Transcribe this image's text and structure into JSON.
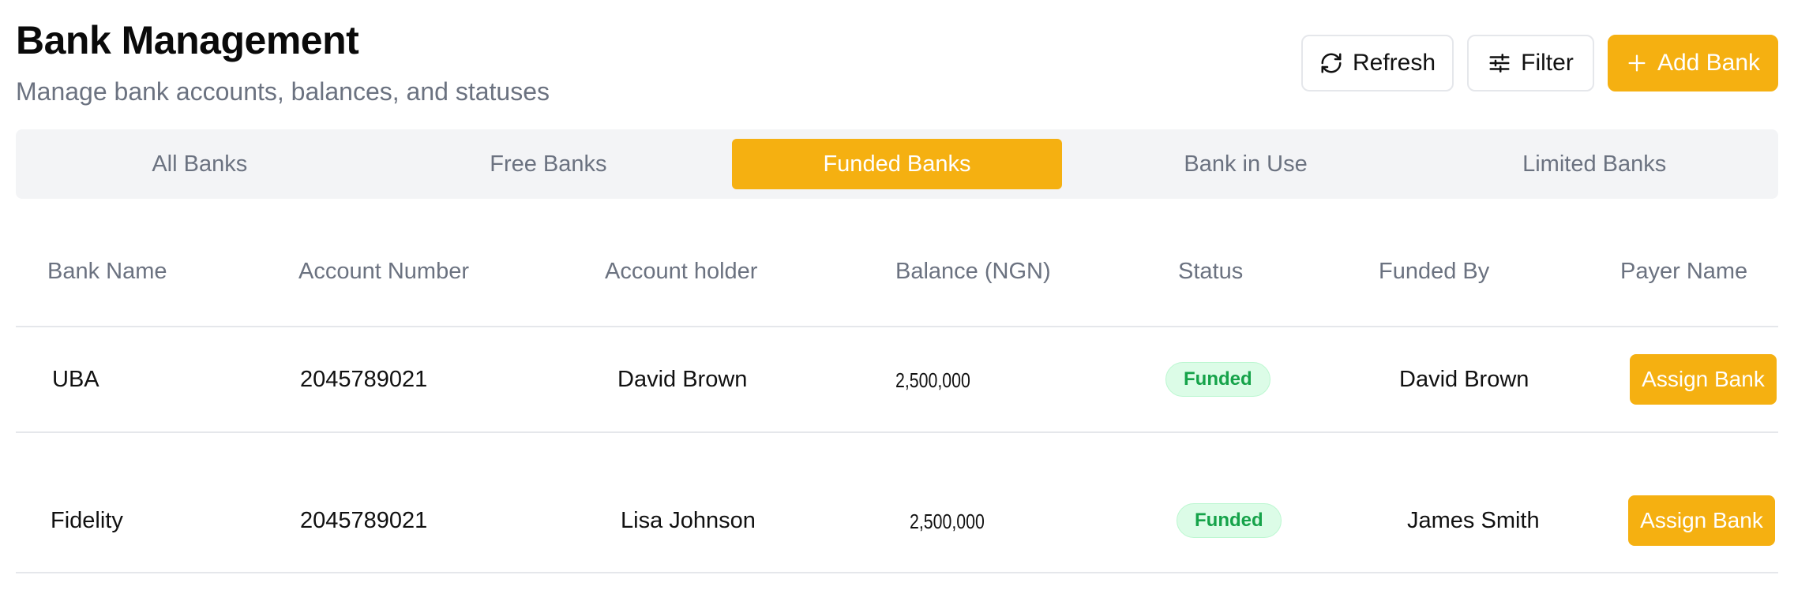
{
  "header": {
    "title": "Bank Management",
    "subtitle": "Manage bank accounts, balances, and statuses"
  },
  "toolbar": {
    "refresh_label": "Refresh",
    "filter_label": "Filter",
    "add_label": "Add Bank"
  },
  "tabs": [
    {
      "label": "All Banks",
      "active": false
    },
    {
      "label": "Free Banks",
      "active": false
    },
    {
      "label": "Funded Banks",
      "active": true
    },
    {
      "label": "Bank in Use",
      "active": false
    },
    {
      "label": "Limited Banks",
      "active": false
    }
  ],
  "table": {
    "columns": [
      "Bank Name",
      "Account Number",
      "Account holder",
      "Balance (NGN)",
      "Status",
      "Funded By",
      "Payer Name"
    ],
    "rows": [
      {
        "bank_name": "UBA",
        "account_number": "2045789021",
        "account_holder": "David Brown",
        "balance": "2,500,000",
        "status": "Funded",
        "funded_by": "David Brown",
        "action": "Assign Bank"
      },
      {
        "bank_name": "Fidelity",
        "account_number": "2045789021",
        "account_holder": "Lisa Johnson",
        "balance": "2,500,000",
        "status": "Funded",
        "funded_by": "James Smith",
        "action": "Assign Bank"
      }
    ]
  },
  "colors": {
    "accent": "#f5b011",
    "status_funded_bg": "#dcfce7",
    "status_funded_text": "#16a34a",
    "muted_text": "#6b7280"
  },
  "icons": {
    "refresh": "refresh-icon",
    "filter": "sliders-icon",
    "add": "plus-icon"
  }
}
